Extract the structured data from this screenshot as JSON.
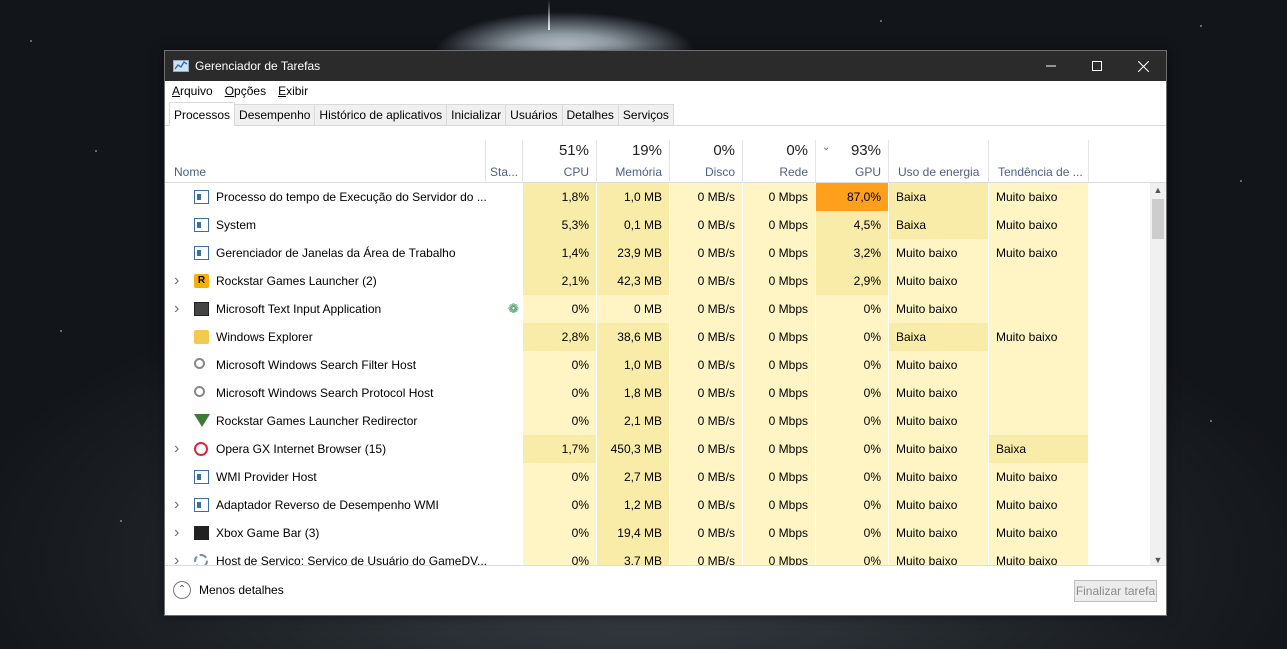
{
  "window": {
    "title": "Gerenciador de Tarefas"
  },
  "menu": [
    "Arquivo",
    "Opções",
    "Exibir"
  ],
  "tabs": [
    "Processos",
    "Desempenho",
    "Histórico de aplicativos",
    "Inicializar",
    "Usuários",
    "Detalhes",
    "Serviços"
  ],
  "columns": {
    "name": "Nome",
    "status": "Sta...",
    "cpu": {
      "pct": "51%",
      "label": "CPU"
    },
    "mem": {
      "pct": "19%",
      "label": "Memória"
    },
    "disk": {
      "pct": "0%",
      "label": "Disco"
    },
    "net": {
      "pct": "0%",
      "label": "Rede"
    },
    "gpu": {
      "pct": "93%",
      "label": "GPU"
    },
    "power": "Uso de energia",
    "trend": "Tendência de ..."
  },
  "rows": [
    {
      "name": "Processo do tempo de Execução do Servidor do ...",
      "icon": "app-icon",
      "expandable": false,
      "cpu": "1,8%",
      "mem": "1,0 MB",
      "disk": "0 MB/s",
      "net": "0 Mbps",
      "gpu": "87,0%",
      "power": "Baixa",
      "trend": "Muito baixo"
    },
    {
      "name": "System",
      "icon": "app-icon",
      "expandable": false,
      "cpu": "5,3%",
      "mem": "0,1 MB",
      "disk": "0 MB/s",
      "net": "0 Mbps",
      "gpu": "4,5%",
      "power": "Baixa",
      "trend": "Muito baixo"
    },
    {
      "name": "Gerenciador de Janelas da Área de Trabalho",
      "icon": "app-icon",
      "expandable": false,
      "cpu": "1,4%",
      "mem": "23,9 MB",
      "disk": "0 MB/s",
      "net": "0 Mbps",
      "gpu": "3,2%",
      "power": "Muito baixo",
      "trend": "Muito baixo"
    },
    {
      "name": "Rockstar Games Launcher (2)",
      "icon": "rockstar-icon",
      "expandable": true,
      "cpu": "2,1%",
      "mem": "42,3 MB",
      "disk": "0 MB/s",
      "net": "0 Mbps",
      "gpu": "2,9%",
      "power": "Muito baixo",
      "trend": ""
    },
    {
      "name": "Microsoft Text Input Application",
      "icon": "keyboard-icon",
      "expandable": true,
      "status_icon": "leaf-icon",
      "cpu": "0%",
      "mem": "0 MB",
      "disk": "0 MB/s",
      "net": "0 Mbps",
      "gpu": "0%",
      "power": "Muito baixo",
      "trend": ""
    },
    {
      "name": "Windows Explorer",
      "icon": "folder-icon",
      "expandable": false,
      "cpu": "2,8%",
      "mem": "38,6 MB",
      "disk": "0 MB/s",
      "net": "0 Mbps",
      "gpu": "0%",
      "power": "Baixa",
      "trend": "Muito baixo"
    },
    {
      "name": "Microsoft Windows Search Filter Host",
      "icon": "search-icon",
      "expandable": false,
      "cpu": "0%",
      "mem": "1,0 MB",
      "disk": "0 MB/s",
      "net": "0 Mbps",
      "gpu": "0%",
      "power": "Muito baixo",
      "trend": ""
    },
    {
      "name": "Microsoft Windows Search Protocol Host",
      "icon": "search-icon",
      "expandable": false,
      "cpu": "0%",
      "mem": "1,8 MB",
      "disk": "0 MB/s",
      "net": "0 Mbps",
      "gpu": "0%",
      "power": "Muito baixo",
      "trend": ""
    },
    {
      "name": "Rockstar Games Launcher Redirector",
      "icon": "v-icon",
      "expandable": false,
      "cpu": "0%",
      "mem": "2,1 MB",
      "disk": "0 MB/s",
      "net": "0 Mbps",
      "gpu": "0%",
      "power": "Muito baixo",
      "trend": ""
    },
    {
      "name": "Opera GX Internet Browser (15)",
      "icon": "opera-icon",
      "expandable": true,
      "cpu": "1,7%",
      "mem": "450,3 MB",
      "disk": "0 MB/s",
      "net": "0 Mbps",
      "gpu": "0%",
      "power": "Muito baixo",
      "trend": "Baixa"
    },
    {
      "name": "WMI Provider Host",
      "icon": "app-icon",
      "expandable": false,
      "cpu": "0%",
      "mem": "2,7 MB",
      "disk": "0 MB/s",
      "net": "0 Mbps",
      "gpu": "0%",
      "power": "Muito baixo",
      "trend": "Muito baixo"
    },
    {
      "name": "Adaptador Reverso de Desempenho WMI",
      "icon": "app-icon",
      "expandable": true,
      "cpu": "0%",
      "mem": "1,2 MB",
      "disk": "0 MB/s",
      "net": "0 Mbps",
      "gpu": "0%",
      "power": "Muito baixo",
      "trend": "Muito baixo"
    },
    {
      "name": "Xbox Game Bar (3)",
      "icon": "xbox-icon",
      "expandable": true,
      "cpu": "0%",
      "mem": "19,4 MB",
      "disk": "0 MB/s",
      "net": "0 Mbps",
      "gpu": "0%",
      "power": "Muito baixo",
      "trend": "Muito baixo"
    },
    {
      "name": "Host de Serviço: Serviço de Usuário do GameDV...",
      "icon": "gear-icon",
      "expandable": true,
      "cpu": "0%",
      "mem": "3,7 MB",
      "disk": "0 MB/s",
      "net": "0 Mbps",
      "gpu": "0%",
      "power": "Muito baixo",
      "trend": "Muito baixo"
    }
  ],
  "footer": {
    "less_details": "Menos detalhes",
    "end_task": "Finalizar tarefa"
  },
  "colors": {
    "titlebar": "#2b2b2b",
    "heat_light": "#fff4c4",
    "heat_mid": "#f9eca8",
    "heat_strong": "#ffa01c",
    "header_label": "#4d6082"
  }
}
